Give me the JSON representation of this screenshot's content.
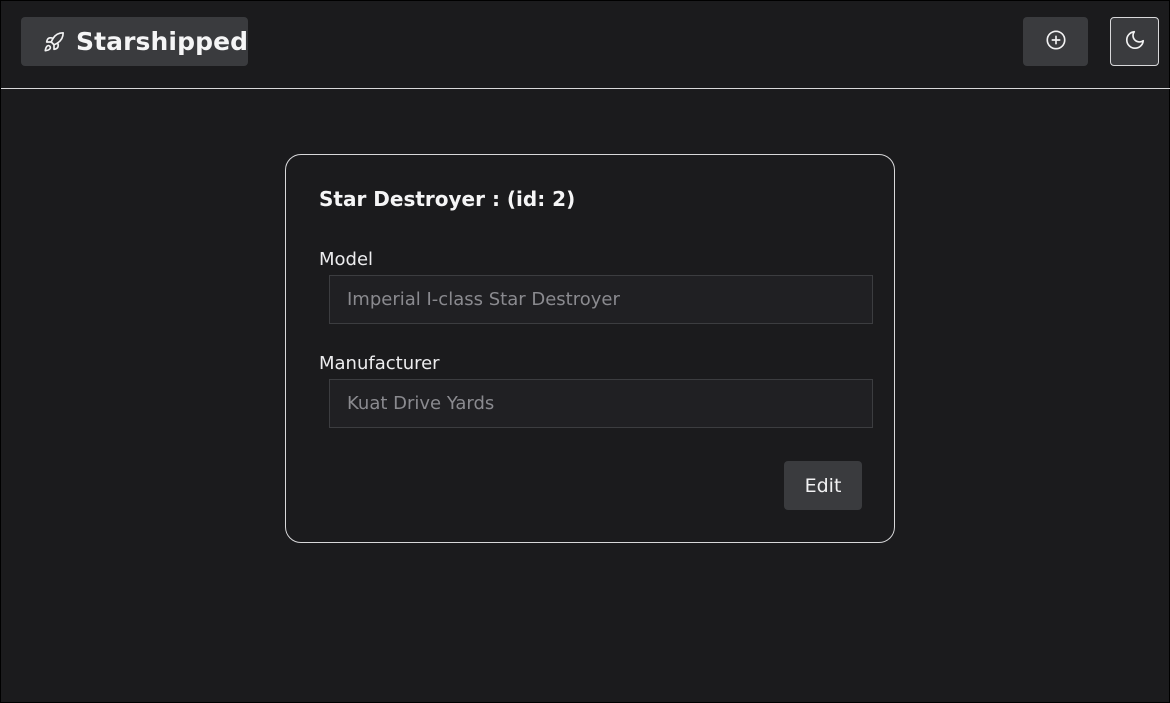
{
  "header": {
    "brand_icon": "rocket-icon",
    "brand_title": "Starshipped",
    "add_button_icon": "plus-circle-icon",
    "theme_button_icon": "moon-icon"
  },
  "card": {
    "title": "Star Destroyer : (id: 2)",
    "fields": [
      {
        "label": "Model",
        "placeholder": "Imperial I-class Star Destroyer"
      },
      {
        "label": "Manufacturer",
        "placeholder": "Kuat Drive Yards"
      }
    ],
    "edit_label": "Edit"
  },
  "colors": {
    "background": "#1b1b1d",
    "button": "#3a3b3e",
    "border": "#d8d8da",
    "input_bg": "#202023",
    "placeholder_text": "#8a8a8f"
  }
}
